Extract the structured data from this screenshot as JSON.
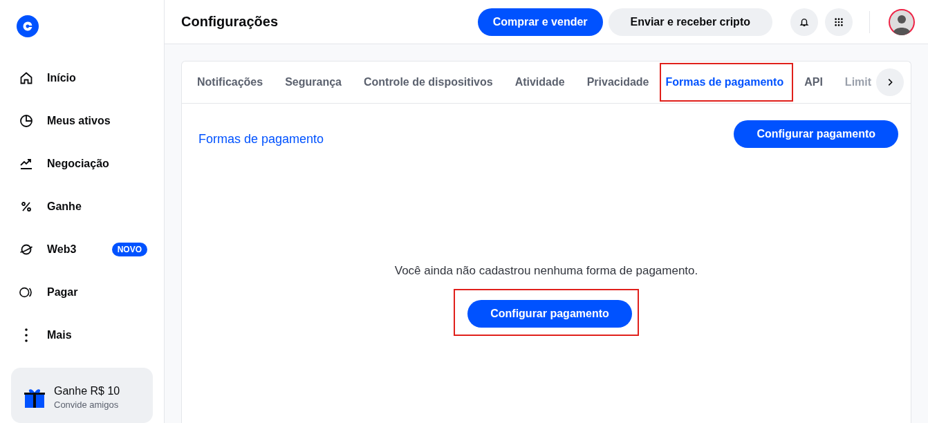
{
  "sidebar": {
    "items": [
      {
        "label": "Início"
      },
      {
        "label": "Meus ativos"
      },
      {
        "label": "Negociação"
      },
      {
        "label": "Ganhe"
      },
      {
        "label": "Web3",
        "badge": "NOVO"
      },
      {
        "label": "Pagar"
      },
      {
        "label": "Mais"
      }
    ],
    "promo": {
      "title": "Ganhe R$ 10",
      "subtitle": "Convide amigos"
    }
  },
  "header": {
    "title": "Configurações",
    "buttons": [
      {
        "kind": "primary",
        "label": "Comprar e vender"
      },
      {
        "kind": "secondary",
        "label": "Enviar e receber cripto"
      }
    ]
  },
  "tabs": [
    {
      "label": "Notificações",
      "selected": false,
      "highlighted": false
    },
    {
      "label": "Segurança",
      "selected": false,
      "highlighted": false
    },
    {
      "label": "Controle de dispositivos",
      "selected": false,
      "highlighted": false
    },
    {
      "label": "Atividade",
      "selected": false,
      "highlighted": false
    },
    {
      "label": "Privacidade",
      "selected": false,
      "highlighted": false
    },
    {
      "label": "Formas de pagamento",
      "selected": true,
      "highlighted": true
    },
    {
      "label": "API",
      "selected": false,
      "highlighted": false
    },
    {
      "label": "Limit",
      "selected": false,
      "highlighted": false
    }
  ],
  "section": {
    "title": "Formas de pagamento",
    "button": "Configurar pagamento"
  },
  "empty_state": {
    "message": "Você ainda não cadastrou nenhuma forma de pagamento.",
    "button": "Configurar pagamento",
    "highlighted": true
  }
}
